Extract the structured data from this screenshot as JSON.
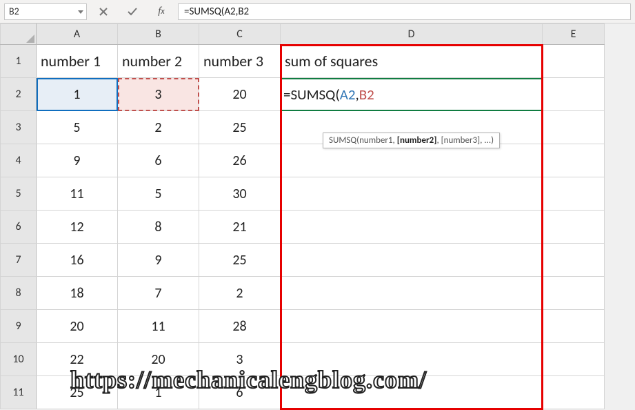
{
  "namebox": "B2",
  "formula_bar": "=SUMSQ(A2,B2",
  "tooltip_prefix": "SUMSQ(number1, ",
  "tooltip_bold": "[number2]",
  "tooltip_suffix": ", [number3], ...)",
  "columns": [
    "A",
    "B",
    "C",
    "D",
    "E"
  ],
  "rows": [
    "1",
    "2",
    "3",
    "4",
    "5",
    "6",
    "7",
    "8",
    "9",
    "10",
    "11"
  ],
  "headers": {
    "A": "number 1",
    "B": "number 2",
    "C": "number 3",
    "D": "sum of squares"
  },
  "active_formula": {
    "fn": "=SUMSQ(",
    "a2": "A2",
    "sep": ",",
    "b2": "B2"
  },
  "table": [
    {
      "A": "1",
      "B": "3",
      "C": "20"
    },
    {
      "A": "5",
      "B": "2",
      "C": "25"
    },
    {
      "A": "9",
      "B": "6",
      "C": "26"
    },
    {
      "A": "11",
      "B": "5",
      "C": "30"
    },
    {
      "A": "12",
      "B": "8",
      "C": "21"
    },
    {
      "A": "16",
      "B": "9",
      "C": "25"
    },
    {
      "A": "18",
      "B": "7",
      "C": "2"
    },
    {
      "A": "20",
      "B": "11",
      "C": "28"
    },
    {
      "A": "22",
      "B": "20",
      "C": "3"
    },
    {
      "A": "25",
      "B": "1",
      "C": "6"
    }
  ],
  "watermark": "https://mechanicalengblog.com/",
  "chart_data": {
    "type": "table",
    "title": "sum of squares",
    "columns": [
      "number 1",
      "number 2",
      "number 3"
    ],
    "rows": [
      [
        1,
        3,
        20
      ],
      [
        5,
        2,
        25
      ],
      [
        9,
        6,
        26
      ],
      [
        11,
        5,
        30
      ],
      [
        12,
        8,
        21
      ],
      [
        16,
        9,
        25
      ],
      [
        18,
        7,
        2
      ],
      [
        20,
        11,
        28
      ],
      [
        22,
        20,
        3
      ],
      [
        25,
        1,
        6
      ]
    ],
    "formula_in_D2": "=SUMSQ(A2,B2"
  }
}
